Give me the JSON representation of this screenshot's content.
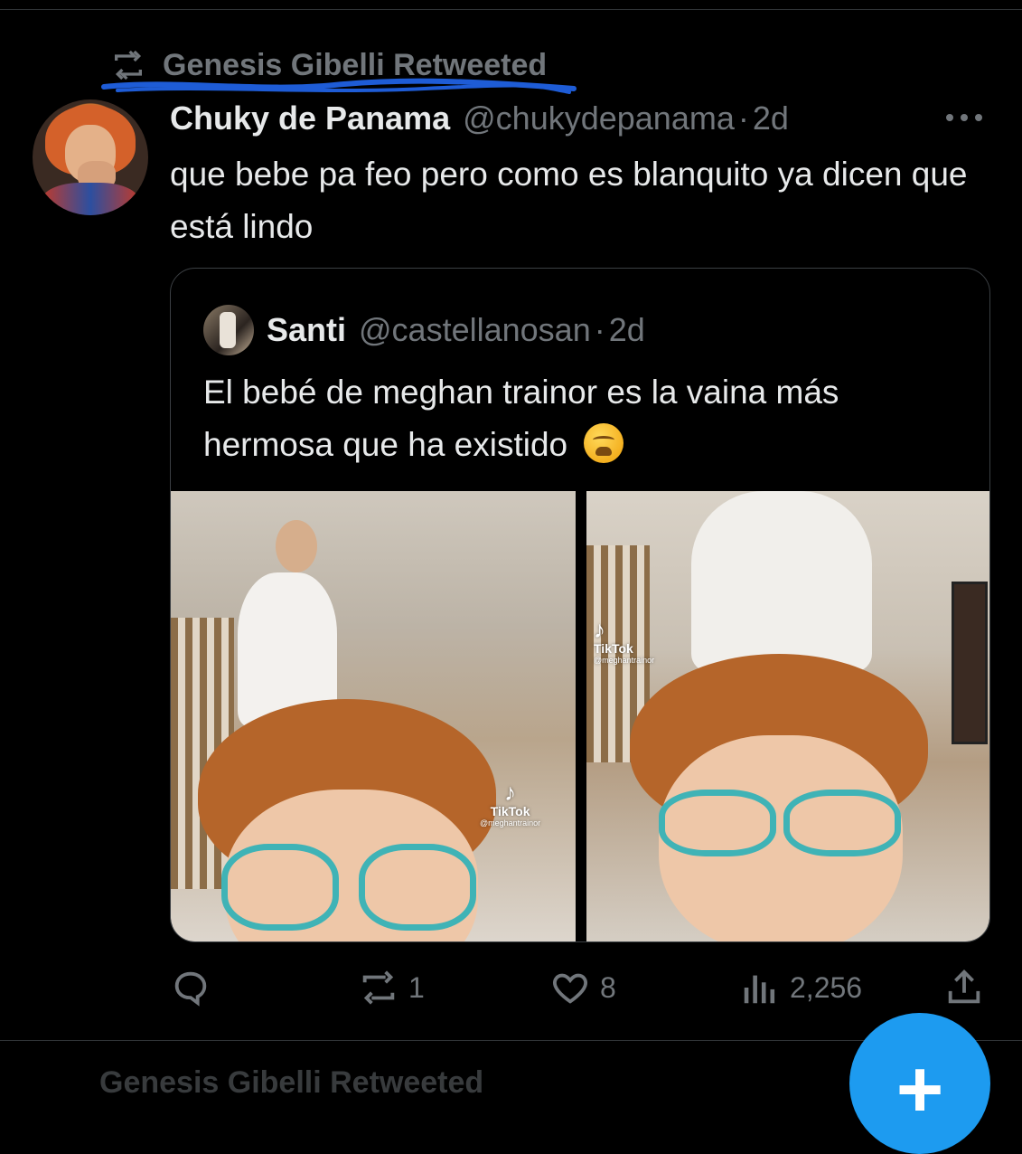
{
  "retweet": {
    "label": "Genesis Gibelli Retweeted"
  },
  "tweet": {
    "display_name": "Chuky de Panama",
    "handle": "@chukydepanama",
    "separator": "·",
    "time": "2d",
    "text": "que bebe pa feo pero como es blanquito ya dicen que está lindo"
  },
  "quote": {
    "display_name": "Santi",
    "handle": "@castellanosan",
    "separator": "·",
    "time": "2d",
    "text": "El bebé de meghan trainor es la vaina más hermosa que ha existido",
    "emoji": "weary-face-emoji",
    "media": [
      {
        "watermark": "TikTok",
        "watermark_handle": "@meghantrainor"
      },
      {
        "watermark": "TikTok",
        "watermark_handle": "@meghantrainor"
      }
    ]
  },
  "actions": {
    "replies": "",
    "retweets": "1",
    "likes": "8",
    "views": "2,256"
  },
  "fab": {
    "label": "+"
  },
  "next_retweet": {
    "label": "Genesis Gibelli Retweeted"
  },
  "colors": {
    "background": "#000000",
    "text": "#e7e9ea",
    "secondary": "#71767b",
    "accent": "#1d9bf0",
    "annotation_scribble": "#1e5cd6"
  }
}
